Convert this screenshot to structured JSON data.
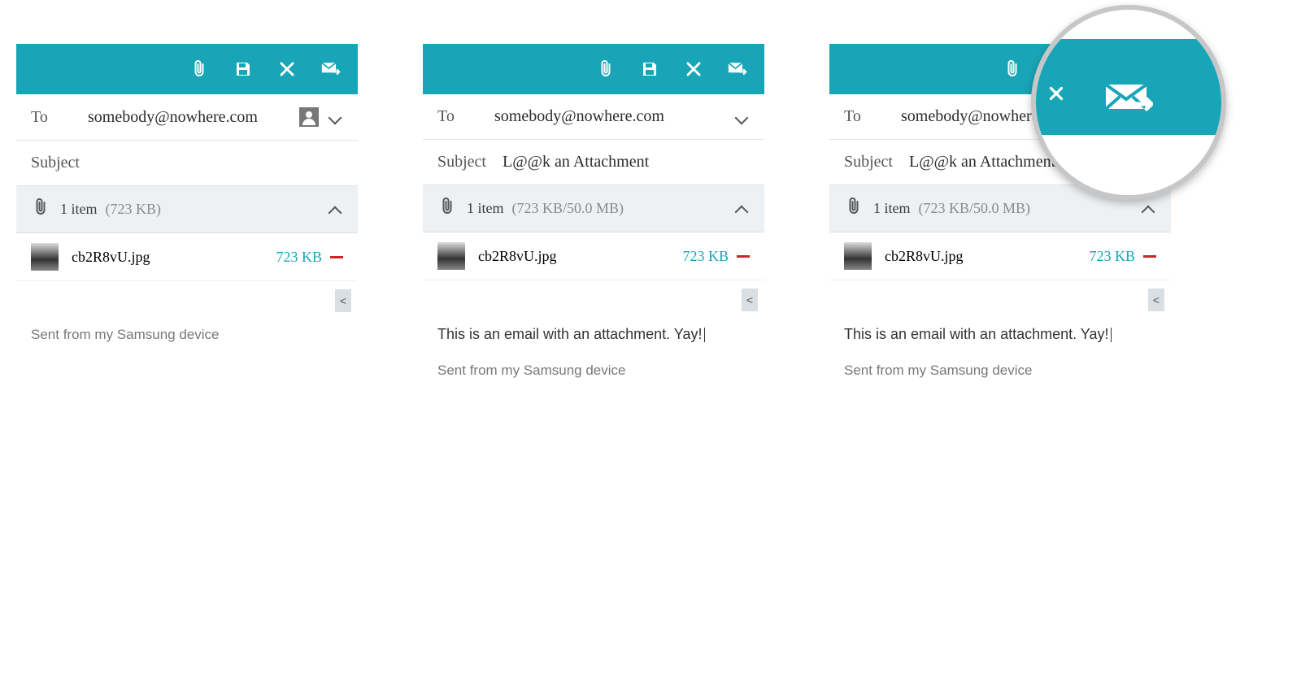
{
  "screens": [
    {
      "to_label": "To",
      "to_value": "somebody@nowhere.com",
      "show_contact_icon": true,
      "subject_label": "Subject",
      "subject_value": "",
      "attach_count": "1 item",
      "attach_size": "(723 KB)",
      "file_name": "cb2R8vU.jpg",
      "file_size": "723 KB",
      "body_text": "",
      "signature": "Sent from my Samsung device"
    },
    {
      "to_label": "To",
      "to_value": "somebody@nowhere.com",
      "show_contact_icon": false,
      "subject_label": "Subject",
      "subject_value": "L@@k an Attachment",
      "attach_count": "1 item",
      "attach_size": "(723 KB/50.0 MB)",
      "file_name": "cb2R8vU.jpg",
      "file_size": "723 KB",
      "body_text": "This is an email with an attachment.  Yay!",
      "signature": "Sent from my Samsung device"
    },
    {
      "to_label": "To",
      "to_value": "somebody@nowhere.com",
      "show_contact_icon": false,
      "subject_label": "Subject",
      "subject_value": "L@@k an Attachment",
      "attach_count": "1 item",
      "attach_size": "(723 KB/50.0 MB)",
      "file_name": "cb2R8vU.jpg",
      "file_size": "723 KB",
      "body_text": "This is an email with an attachment.  Yay!",
      "signature": "Sent from my Samsung device"
    }
  ],
  "toolbar_icons": [
    "attach-icon",
    "save-icon",
    "close-icon",
    "send-icon"
  ]
}
